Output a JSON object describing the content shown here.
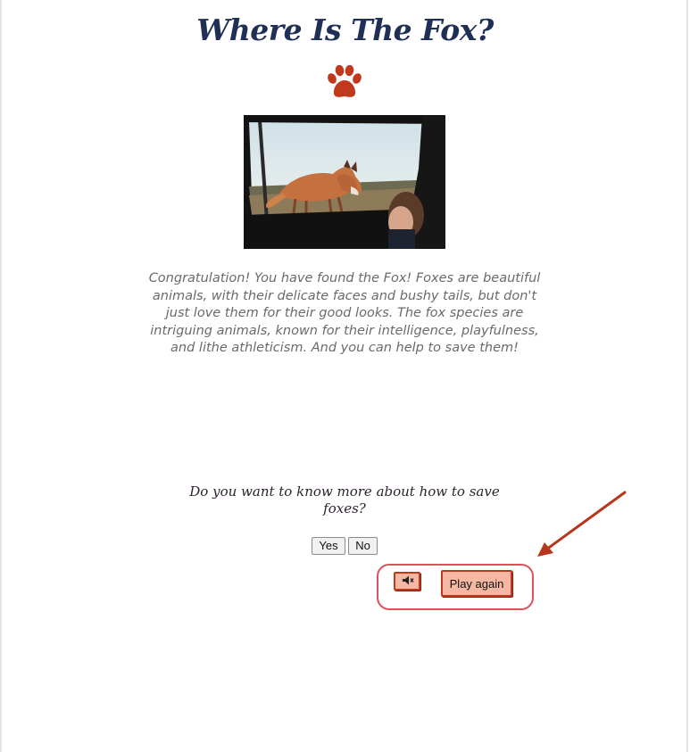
{
  "title": "Where Is The Fox?",
  "message": "Congratulation! You have found the Fox!    Foxes are beautiful animals, with their delicate faces and bushy tails, but don't just love them for their good looks.    The fox species are intriguing animals, known for their intelligence, playfulness, and lithe athleticism.    And you can help to save them!",
  "question": "Do you want to know more about how to save foxes?",
  "buttons": {
    "yes_label": "Yes",
    "no_label": "No",
    "play_again_label": "Play again"
  },
  "icons": {
    "paw": "paw-icon",
    "mute": "mute-speaker-icon"
  },
  "colors": {
    "title": "#1f2f55",
    "paw": "#c0391d",
    "button_fill": "#f6b7a3",
    "button_border": "#c0391d",
    "highlight": "#e0505a",
    "arrow": "#b5371c"
  }
}
